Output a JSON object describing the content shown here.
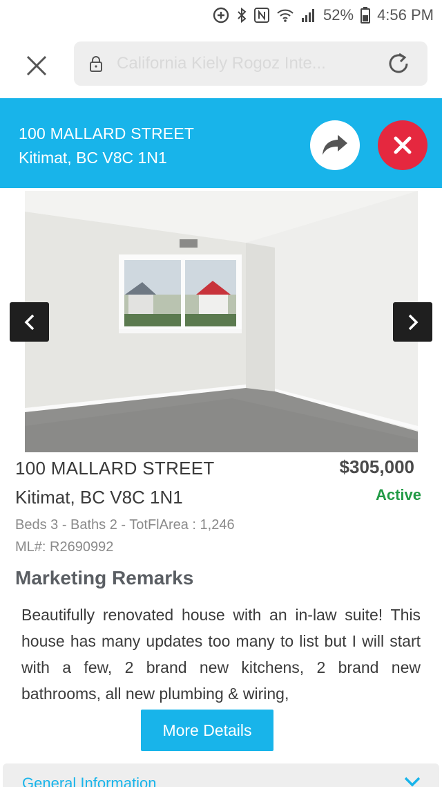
{
  "status_bar": {
    "battery": "52%",
    "time": "4:56 PM",
    "icons": [
      "add-circle-icon",
      "bluetooth-icon",
      "nfc-icon",
      "wifi-icon",
      "signal-icon",
      "battery-icon"
    ]
  },
  "browser": {
    "url": "California Kiely Rogoz Inte..."
  },
  "header": {
    "address_line1": "100 MALLARD STREET",
    "address_line2": "Kitimat, BC V8C 1N1"
  },
  "listing": {
    "street": "100 MALLARD STREET",
    "city": "Kitimat, BC V8C 1N1",
    "price": "$305,000",
    "status": "Active",
    "specs": "Beds 3 - Baths 2 - TotFlArea : 1,246",
    "mls_label": "ML#:",
    "mls_number": "R2690992"
  },
  "remarks": {
    "heading": "Marketing Remarks",
    "text": "Beautifully renovated house with an in-law suite! This house has many updates too many to list but I will start with a few, 2 brand new kitchens, 2 brand new bathrooms, all new plumbing & wiring,"
  },
  "actions": {
    "more_details": "More Details"
  },
  "sections": {
    "general_information": "General Information"
  },
  "colors": {
    "accent": "#18b4ea",
    "dismiss": "#e5283f",
    "active": "#219a45"
  }
}
